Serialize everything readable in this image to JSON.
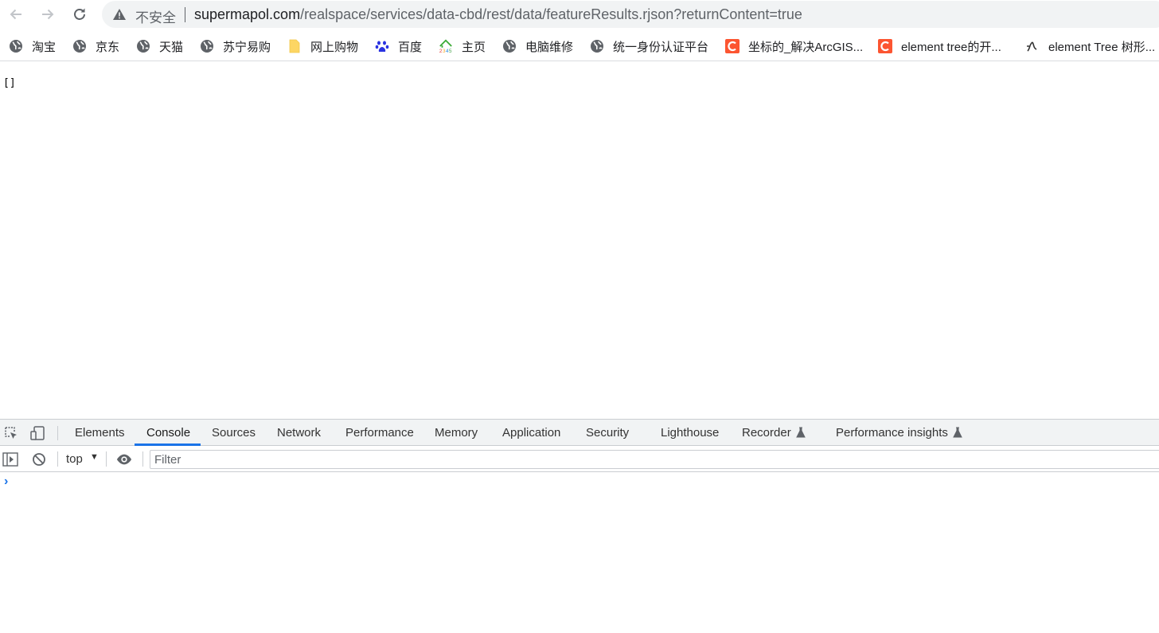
{
  "toolbar": {
    "security_label": "不安全",
    "url_host": "supermapol.com",
    "url_path": "/realspace/services/data-cbd/rest/data/featureResults.rjson?returnContent=true"
  },
  "bookmarks": [
    {
      "label": "淘宝",
      "icon": "globe-icon"
    },
    {
      "label": "京东",
      "icon": "globe-icon"
    },
    {
      "label": "天猫",
      "icon": "globe-icon"
    },
    {
      "label": "苏宁易购",
      "icon": "globe-icon"
    },
    {
      "label": "网上购物",
      "icon": "folder-icon"
    },
    {
      "label": "百度",
      "icon": "baidu-paw-icon"
    },
    {
      "label": "主页",
      "icon": "home-2345-icon"
    },
    {
      "label": "电脑维修",
      "icon": "globe-icon"
    },
    {
      "label": "统一身份认证平台",
      "icon": "globe-icon"
    },
    {
      "label": "坐标的_解决ArcGIS...",
      "icon": "csdn-icon"
    },
    {
      "label": "element tree的开...",
      "icon": "csdn-icon"
    },
    {
      "label": "element Tree 树形...",
      "icon": "script-icon"
    }
  ],
  "page": {
    "content": "[]"
  },
  "devtools": {
    "tabs": [
      "Elements",
      "Console",
      "Sources",
      "Network",
      "Performance",
      "Memory",
      "Application",
      "Security",
      "Lighthouse",
      "Recorder",
      "Performance insights"
    ],
    "active_tab": "Console",
    "context": "top",
    "filter_placeholder": "Filter"
  },
  "colors": {
    "accent": "#1a73e8",
    "csdn": "#fc5531"
  }
}
